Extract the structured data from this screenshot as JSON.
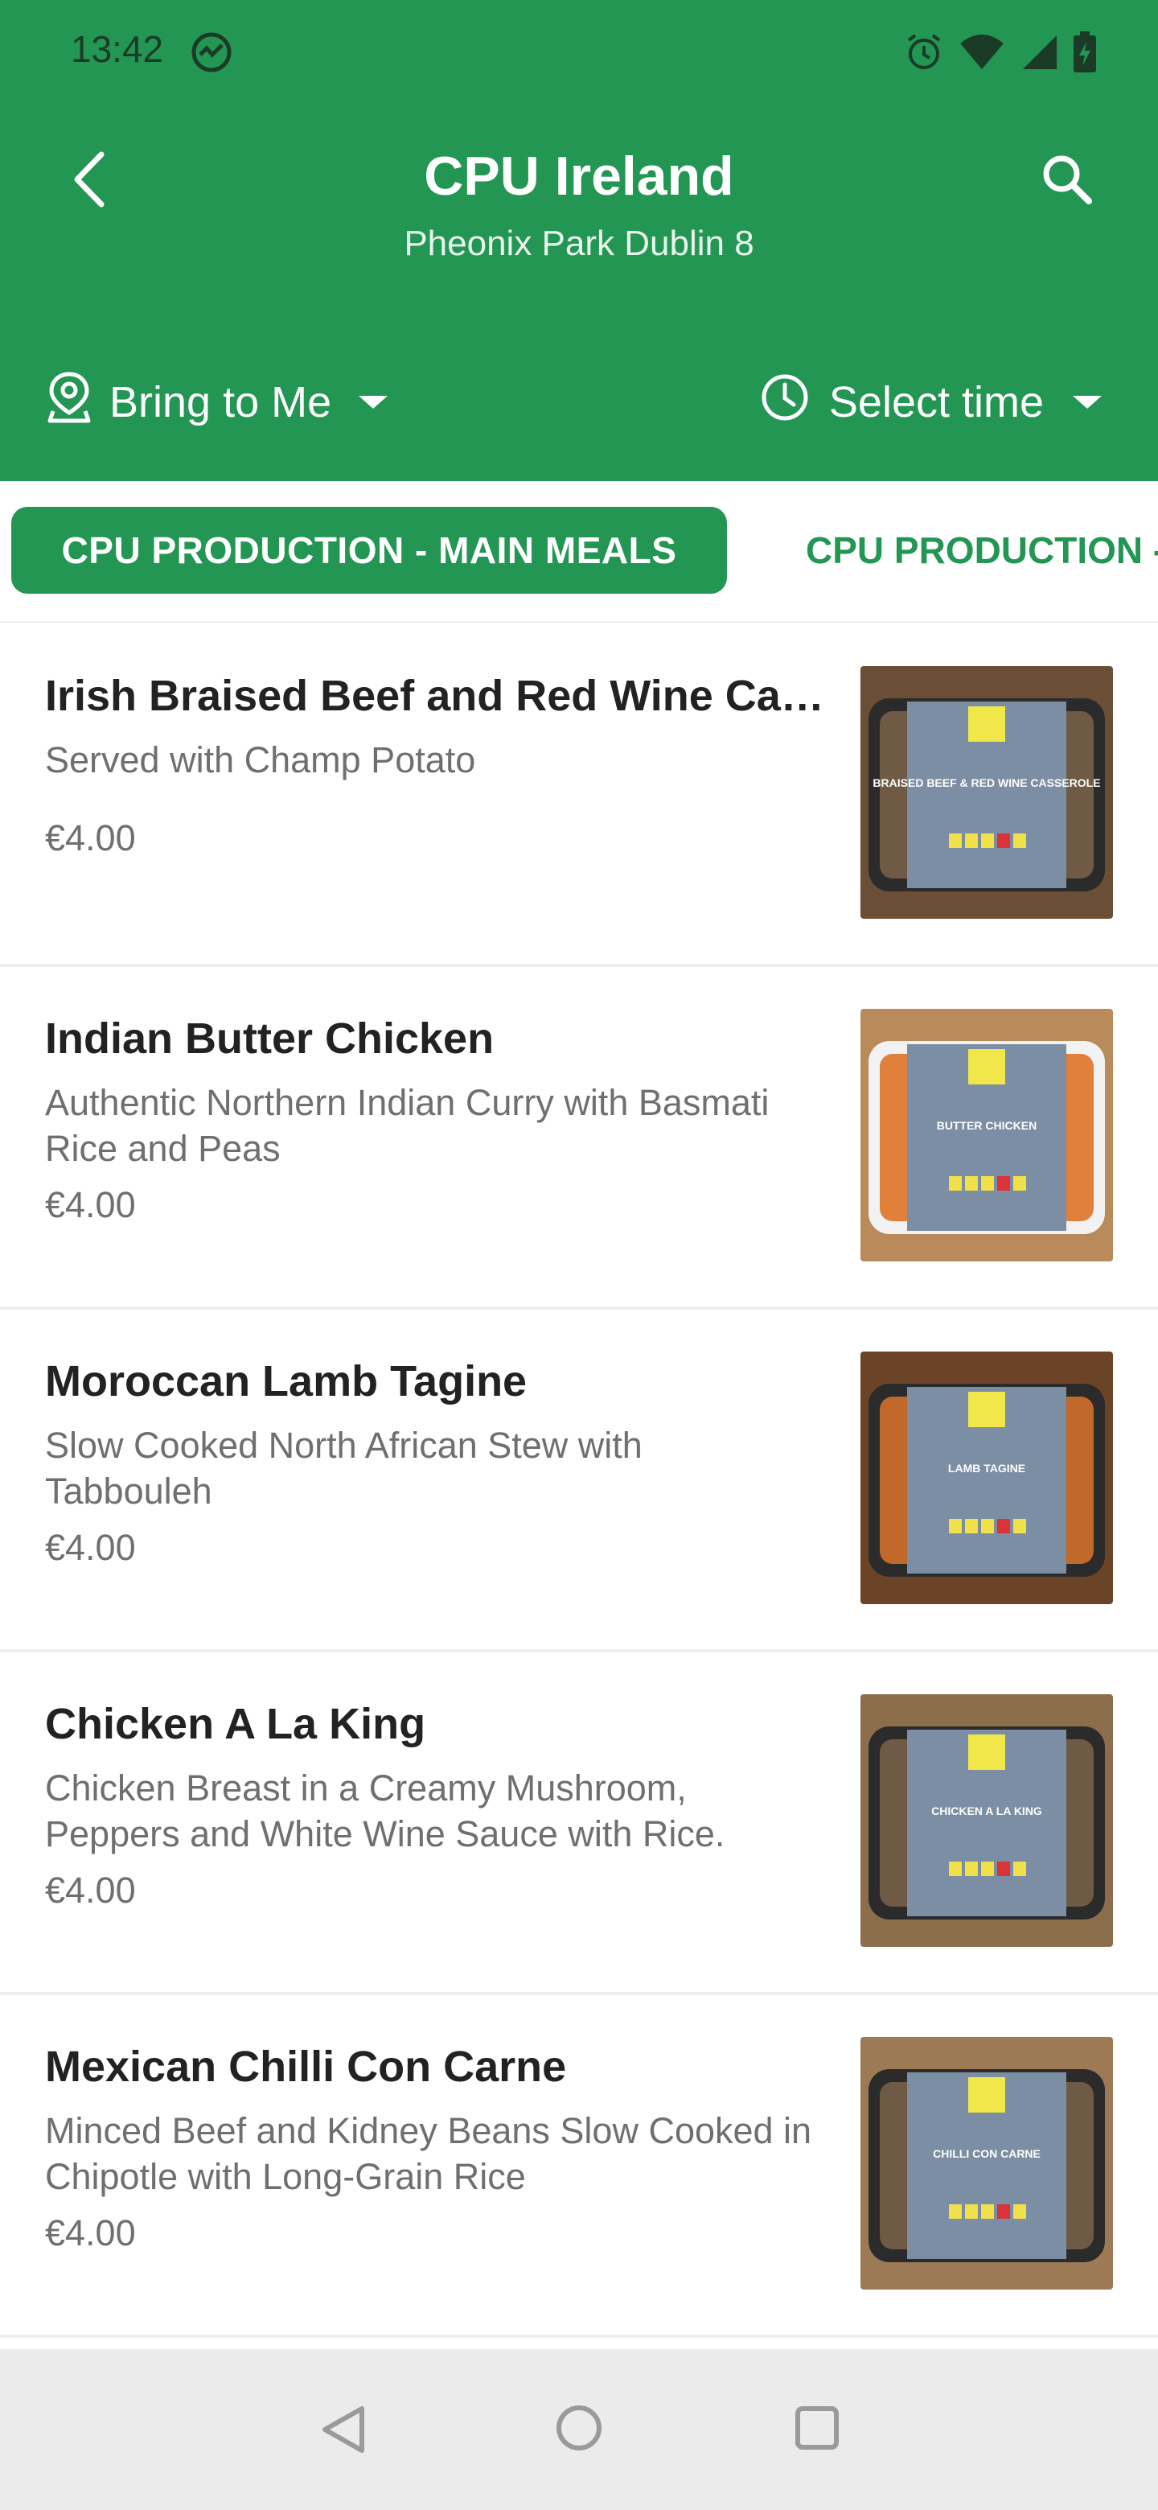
{
  "status_bar": {
    "time": "13:42",
    "icons": [
      "sync-icon",
      "alarm-icon",
      "wifi-icon",
      "signal-icon",
      "battery-icon"
    ]
  },
  "header": {
    "title": "CPU Ireland",
    "subtitle": "Pheonix Park  Dublin 8",
    "back_icon": "chevron-left-icon",
    "search_icon": "search-icon",
    "delivery_mode": "Bring to Me",
    "time_select": "Select time"
  },
  "tabs": [
    {
      "label": "CPU PRODUCTION - MAIN MEALS",
      "active": true
    },
    {
      "label": "CPU PRODUCTION - ",
      "active": false
    }
  ],
  "menu_items": [
    {
      "name": "Irish Braised Beef and Red Wine Cass...",
      "description": "Served with Champ Potato",
      "price": "€4.00",
      "photo_bg": "#6a4e36",
      "photo_label": "BRAISED BEEF & RED WINE CASSEROLE"
    },
    {
      "name": "Indian Butter Chicken",
      "description": "Authentic Northern Indian Curry with Basmati Rice and Peas",
      "price": "€4.00",
      "photo_bg": "#b98a5a",
      "photo_label": "BUTTER CHICKEN"
    },
    {
      "name": "Moroccan Lamb Tagine",
      "description": "Slow Cooked North African Stew with Tabbouleh",
      "price": "€4.00",
      "photo_bg": "#6b4428",
      "photo_label": "LAMB TAGINE"
    },
    {
      "name": "Chicken A La King",
      "description": "Chicken Breast in a Creamy Mushroom, Peppers and White Wine Sauce with Rice.",
      "price": "€4.00",
      "photo_bg": "#8c6d4c",
      "photo_label": "CHICKEN A LA KING"
    },
    {
      "name": "Mexican Chilli Con Carne",
      "description": "Minced Beef and Kidney Beans Slow Cooked in Chipotle with Long-Grain Rice",
      "price": "€4.00",
      "photo_bg": "#9b7a55",
      "photo_label": "CHILLI CON CARNE"
    }
  ],
  "colors": {
    "brand_green": "#239654",
    "text_dark": "#222222",
    "text_muted": "#6f6f6f"
  }
}
